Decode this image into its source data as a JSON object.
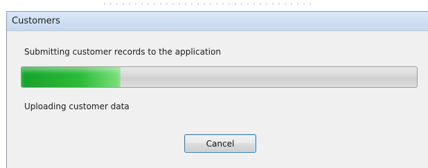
{
  "window": {
    "title": "Customers"
  },
  "dialog": {
    "message": "Submitting customer records to the application",
    "status": "Uploading customer data",
    "progress_fraction": 0.25
  },
  "buttons": {
    "cancel_label": "Cancel"
  }
}
